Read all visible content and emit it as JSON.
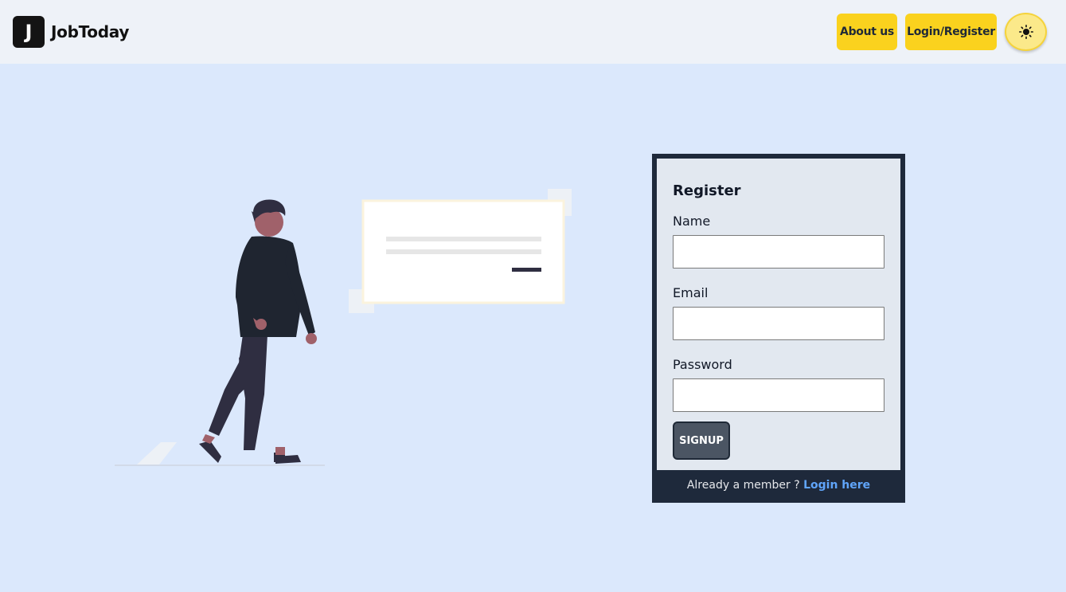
{
  "header": {
    "logo_letter": "J",
    "brand": "JobToday",
    "about_label": "About us",
    "login_label": "Login/Register",
    "theme_icon": "sun-icon"
  },
  "register": {
    "title": "Register",
    "name_label": "Name",
    "name_value": "",
    "email_label": "Email",
    "email_value": "",
    "password_label": "Password",
    "password_value": "",
    "signup_label": "SIGNUP",
    "footer_text": "Already a member ?",
    "footer_link": "Login here"
  },
  "colors": {
    "background": "#dbe8fc",
    "navbar": "#eef2f8",
    "accent": "#fad21e",
    "card_frame": "#1e293b",
    "card_body": "#e2e8f0",
    "link": "#60a5fa"
  }
}
